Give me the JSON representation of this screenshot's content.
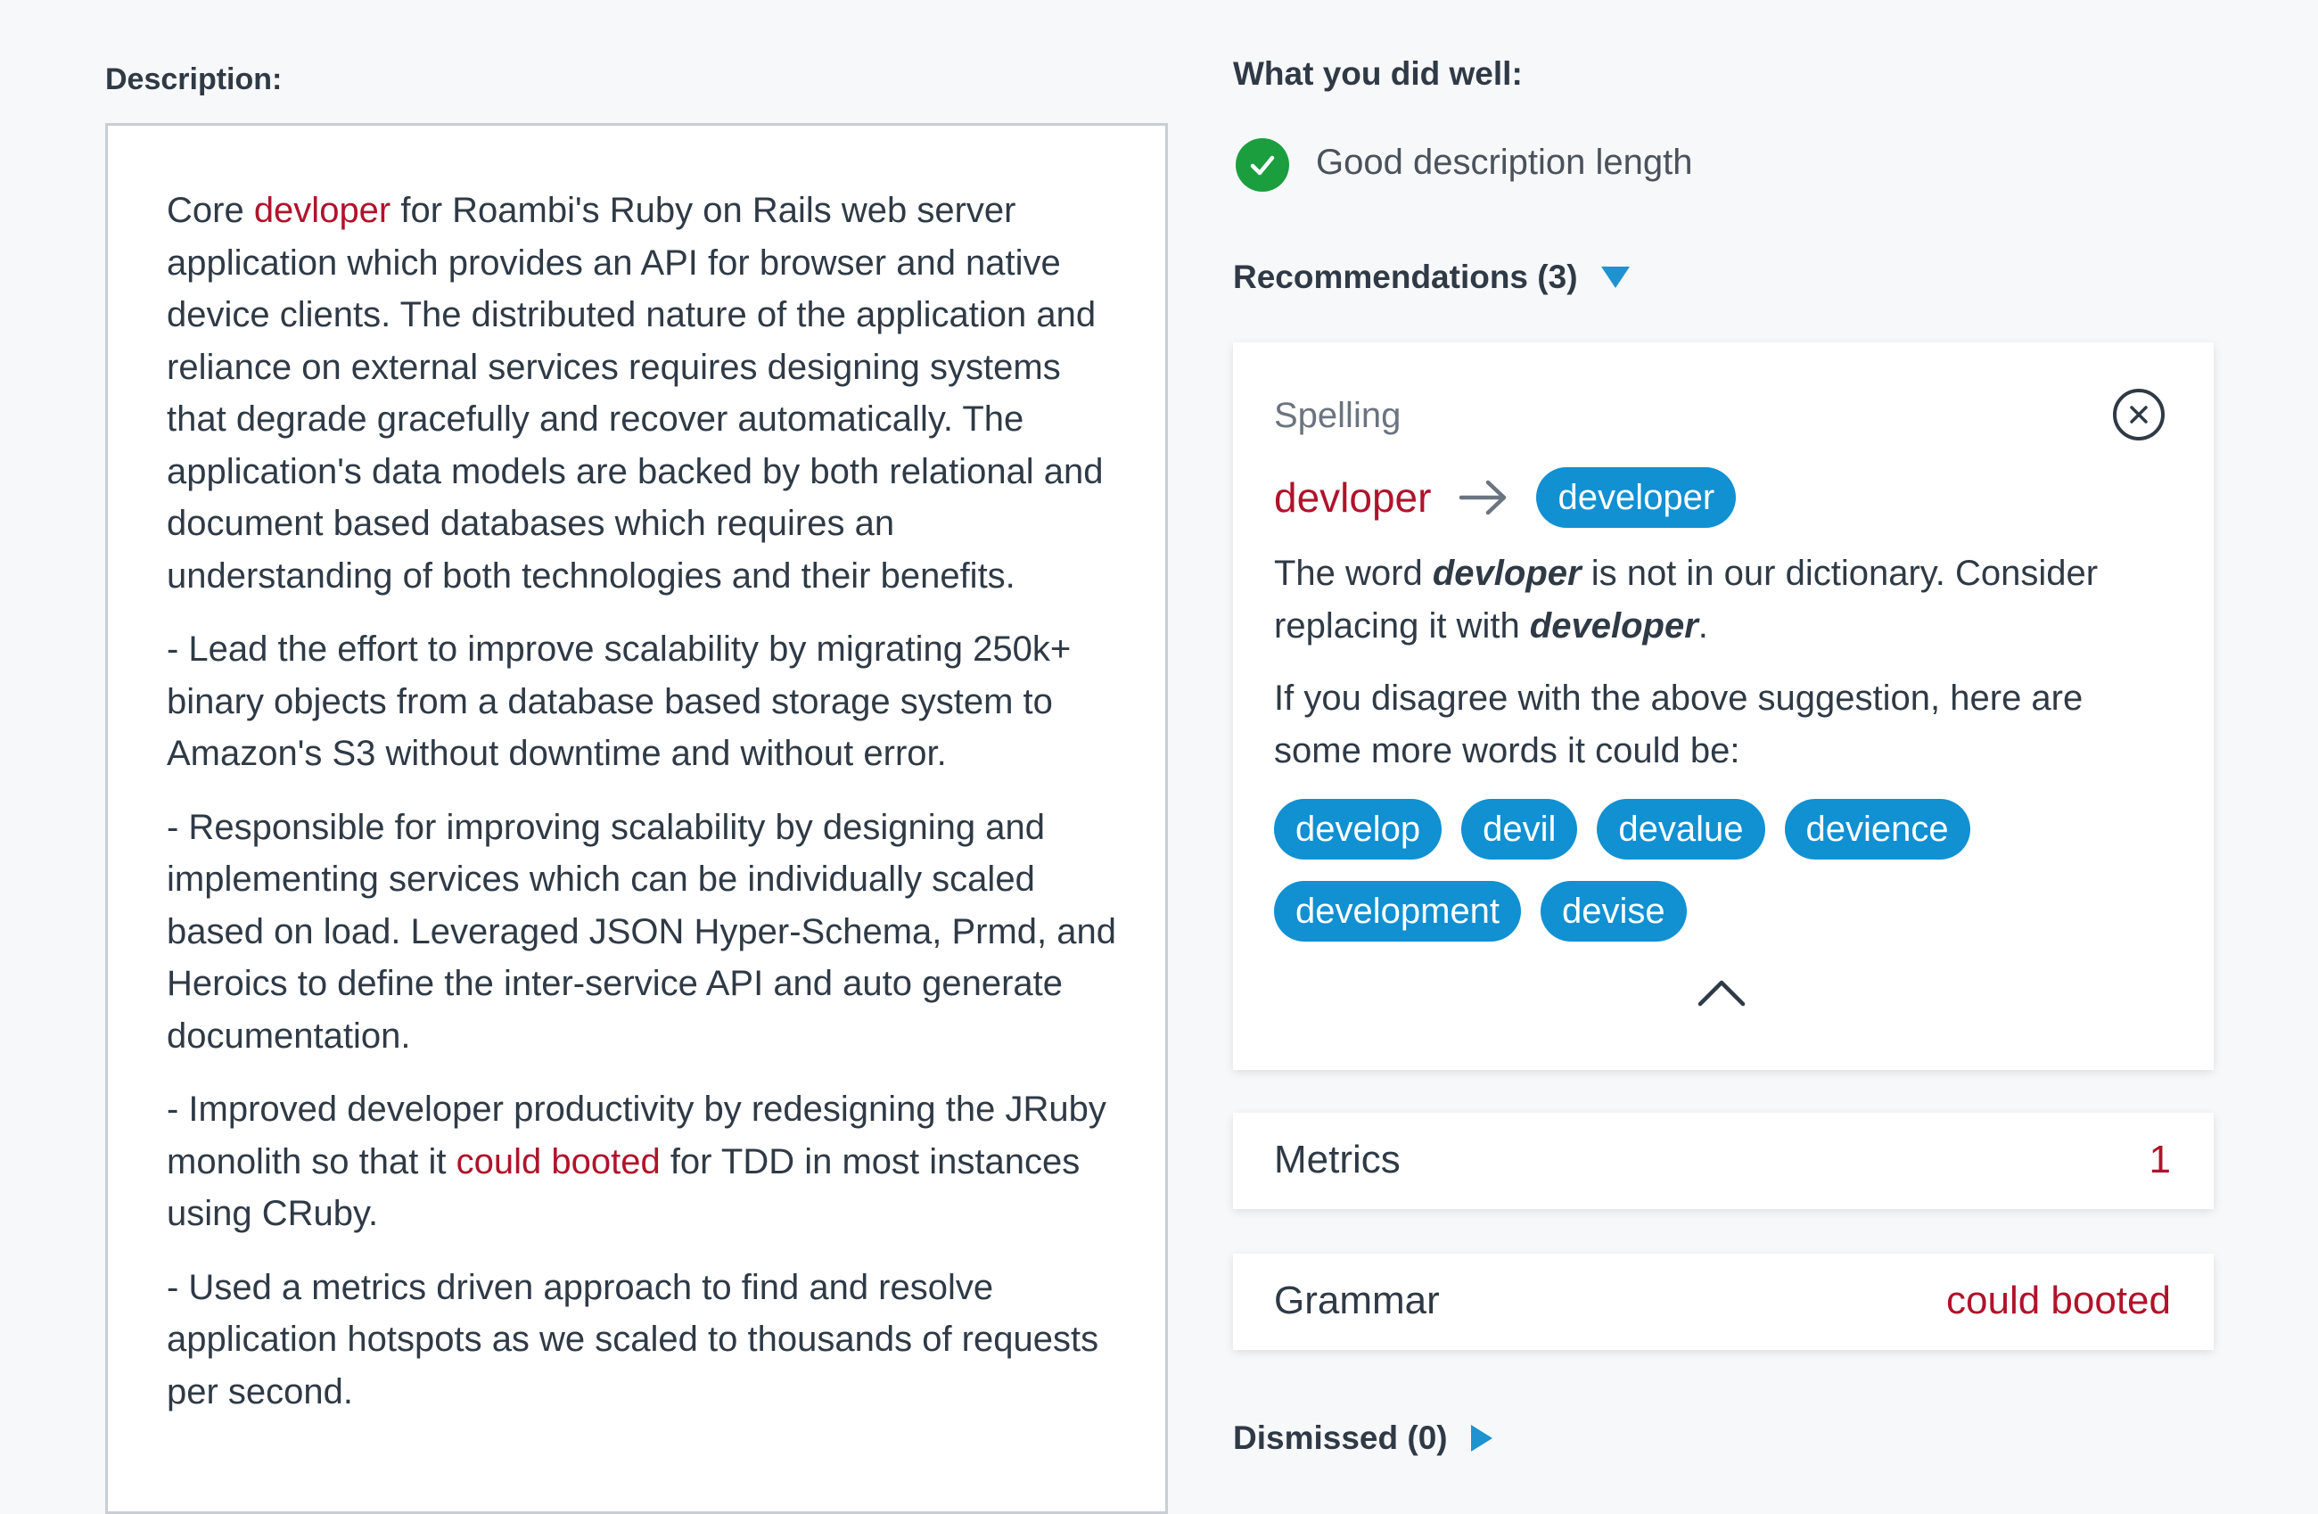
{
  "description": {
    "label": "Description:",
    "paragraph1": {
      "before": "Core ",
      "error": "devloper",
      "after": " for Roambi's Ruby on Rails web server application which provides an API for browser and native device clients. The distributed nature of the application and reliance on external services requires designing systems that degrade gracefully and recover automatically. The application's data models are backed by both relational and document based databases which requires an understanding of both technologies and their benefits."
    },
    "paragraph2": "- Lead the effort to improve scalability by migrating 250k+ binary objects from a database based storage system to Amazon's S3 without downtime and without error.",
    "paragraph3": "- Responsible for improving scalability by designing and implementing services which can be individually scaled based on load. Leveraged JSON Hyper-Schema, Prmd, and Heroics to define the inter-service API and auto generate documentation.",
    "paragraph4": {
      "before": "- Improved developer productivity by redesigning the JRuby monolith so that it ",
      "error": "could booted",
      "after": " for TDD in most instances using CRuby."
    },
    "paragraph5": "- Used a metrics driven approach to find and resolve application hotspots as we scaled to thousands of requests per second."
  },
  "feedback": {
    "well_title": "What you did well:",
    "well_item": "Good description length",
    "recommendations_label": "Recommendations (3)",
    "dismissed_label": "Dismissed (0)"
  },
  "spelling": {
    "category": "Spelling",
    "wrong_word": "devloper",
    "suggestion": "developer",
    "msg_part1": "The word ",
    "msg_word": "devloper",
    "msg_part2": " is not in our dictionary. Consider replacing it with ",
    "msg_suggestion": "developer",
    "msg_part3": ".",
    "alt_message": "If you disagree with the above suggestion, here are some more words it could be:",
    "alternatives": [
      "develop",
      "devil",
      "devalue",
      "devience",
      "development",
      "devise"
    ]
  },
  "metrics": {
    "label": "Metrics",
    "value": "1"
  },
  "grammar": {
    "label": "Grammar",
    "value": "could booted"
  },
  "colors": {
    "error": "#b0132b",
    "chip": "#1190d2",
    "accent": "#1e93d0",
    "success": "#1b9e3e"
  },
  "icons": [
    "check-icon",
    "close-icon",
    "arrow-right-icon",
    "chevron-up-icon",
    "triangle-down-icon",
    "triangle-right-icon"
  ]
}
